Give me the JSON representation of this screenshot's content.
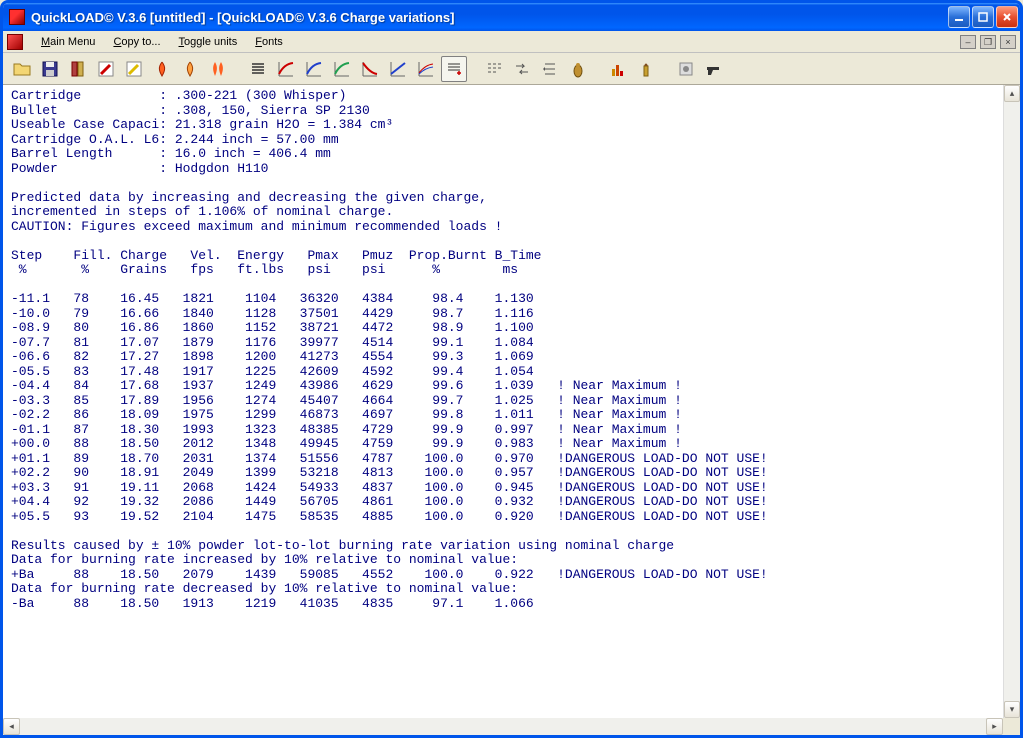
{
  "window": {
    "title": "QuickLOAD© V.3.6   [untitled] - [QuickLOAD© V.3.6 Charge variations]"
  },
  "menu": {
    "main": "Main Menu",
    "copy": "Copy to...",
    "toggle": "Toggle units",
    "fonts": "Fonts"
  },
  "header": {
    "cartridge_label": "Cartridge          :",
    "cartridge_value": ".300-221 (300 Whisper)",
    "bullet_label": "Bullet             :",
    "bullet_value": ".308, 150, Sierra SP 2130",
    "useable_label": "Useable Case Capaci:",
    "useable_value": "21.318 grain H2O = 1.384 cm³",
    "oal_label": "Cartridge O.A.L. L6:",
    "oal_value": "2.244 inch = 57.00 mm",
    "barrel_label": "Barrel Length      :",
    "barrel_value": "16.0 inch = 406.4 mm",
    "powder_label": "Powder             :",
    "powder_value": "Hodgdon H110"
  },
  "predicted_text": "Predicted data by increasing and decreasing the given charge,\nincremented in steps of 1.106% of nominal charge.\nCAUTION: Figures exceed maximum and minimum recommended loads !",
  "columns": {
    "row1": "Step    Fill. Charge   Vel.  Energy   Pmax   Pmuz  Prop.Burnt B_Time",
    "row2": " %       %    Grains   fps   ft.lbs   psi    psi      %        ms"
  },
  "rows": [
    {
      "step": "-11.1",
      "fill": "78",
      "charge": "16.45",
      "vel": "1821",
      "energy": "1104",
      "pmax": "36320",
      "pmuz": "4384",
      "burnt": "98.4",
      "btime": "1.130",
      "note": ""
    },
    {
      "step": "-10.0",
      "fill": "79",
      "charge": "16.66",
      "vel": "1840",
      "energy": "1128",
      "pmax": "37501",
      "pmuz": "4429",
      "burnt": "98.7",
      "btime": "1.116",
      "note": ""
    },
    {
      "step": "-08.9",
      "fill": "80",
      "charge": "16.86",
      "vel": "1860",
      "energy": "1152",
      "pmax": "38721",
      "pmuz": "4472",
      "burnt": "98.9",
      "btime": "1.100",
      "note": ""
    },
    {
      "step": "-07.7",
      "fill": "81",
      "charge": "17.07",
      "vel": "1879",
      "energy": "1176",
      "pmax": "39977",
      "pmuz": "4514",
      "burnt": "99.1",
      "btime": "1.084",
      "note": ""
    },
    {
      "step": "-06.6",
      "fill": "82",
      "charge": "17.27",
      "vel": "1898",
      "energy": "1200",
      "pmax": "41273",
      "pmuz": "4554",
      "burnt": "99.3",
      "btime": "1.069",
      "note": ""
    },
    {
      "step": "-05.5",
      "fill": "83",
      "charge": "17.48",
      "vel": "1917",
      "energy": "1225",
      "pmax": "42609",
      "pmuz": "4592",
      "burnt": "99.4",
      "btime": "1.054",
      "note": ""
    },
    {
      "step": "-04.4",
      "fill": "84",
      "charge": "17.68",
      "vel": "1937",
      "energy": "1249",
      "pmax": "43986",
      "pmuz": "4629",
      "burnt": "99.6",
      "btime": "1.039",
      "note": "! Near Maximum !"
    },
    {
      "step": "-03.3",
      "fill": "85",
      "charge": "17.89",
      "vel": "1956",
      "energy": "1274",
      "pmax": "45407",
      "pmuz": "4664",
      "burnt": "99.7",
      "btime": "1.025",
      "note": "! Near Maximum !"
    },
    {
      "step": "-02.2",
      "fill": "86",
      "charge": "18.09",
      "vel": "1975",
      "energy": "1299",
      "pmax": "46873",
      "pmuz": "4697",
      "burnt": "99.8",
      "btime": "1.011",
      "note": "! Near Maximum !"
    },
    {
      "step": "-01.1",
      "fill": "87",
      "charge": "18.30",
      "vel": "1993",
      "energy": "1323",
      "pmax": "48385",
      "pmuz": "4729",
      "burnt": "99.9",
      "btime": "0.997",
      "note": "! Near Maximum !"
    },
    {
      "step": "+00.0",
      "fill": "88",
      "charge": "18.50",
      "vel": "2012",
      "energy": "1348",
      "pmax": "49945",
      "pmuz": "4759",
      "burnt": "99.9",
      "btime": "0.983",
      "note": "! Near Maximum !"
    },
    {
      "step": "+01.1",
      "fill": "89",
      "charge": "18.70",
      "vel": "2031",
      "energy": "1374",
      "pmax": "51556",
      "pmuz": "4787",
      "burnt": "100.0",
      "btime": "0.970",
      "note": "!DANGEROUS LOAD-DO NOT USE!"
    },
    {
      "step": "+02.2",
      "fill": "90",
      "charge": "18.91",
      "vel": "2049",
      "energy": "1399",
      "pmax": "53218",
      "pmuz": "4813",
      "burnt": "100.0",
      "btime": "0.957",
      "note": "!DANGEROUS LOAD-DO NOT USE!"
    },
    {
      "step": "+03.3",
      "fill": "91",
      "charge": "19.11",
      "vel": "2068",
      "energy": "1424",
      "pmax": "54933",
      "pmuz": "4837",
      "burnt": "100.0",
      "btime": "0.945",
      "note": "!DANGEROUS LOAD-DO NOT USE!"
    },
    {
      "step": "+04.4",
      "fill": "92",
      "charge": "19.32",
      "vel": "2086",
      "energy": "1449",
      "pmax": "56705",
      "pmuz": "4861",
      "burnt": "100.0",
      "btime": "0.932",
      "note": "!DANGEROUS LOAD-DO NOT USE!"
    },
    {
      "step": "+05.5",
      "fill": "93",
      "charge": "19.52",
      "vel": "2104",
      "energy": "1475",
      "pmax": "58535",
      "pmuz": "4885",
      "burnt": "100.0",
      "btime": "0.920",
      "note": "!DANGEROUS LOAD-DO NOT USE!"
    }
  ],
  "results_text1": "Results caused by ± 10% powder lot-to-lot burning rate variation using nominal charge",
  "results_text2": "Data for burning rate increased by 10% relative to nominal value:",
  "ba_plus": {
    "step": "+Ba",
    "fill": "88",
    "charge": "18.50",
    "vel": "2079",
    "energy": "1439",
    "pmax": "59085",
    "pmuz": "4552",
    "burnt": "100.0",
    "btime": "0.922",
    "note": "!DANGEROUS LOAD-DO NOT USE!"
  },
  "results_text3": "Data for burning rate decreased by 10% relative to nominal value:",
  "ba_minus": {
    "step": "-Ba",
    "fill": "88",
    "charge": "18.50",
    "vel": "1913",
    "energy": "1219",
    "pmax": "41035",
    "pmuz": "4835",
    "burnt": "97.1",
    "btime": "1.066",
    "note": ""
  }
}
